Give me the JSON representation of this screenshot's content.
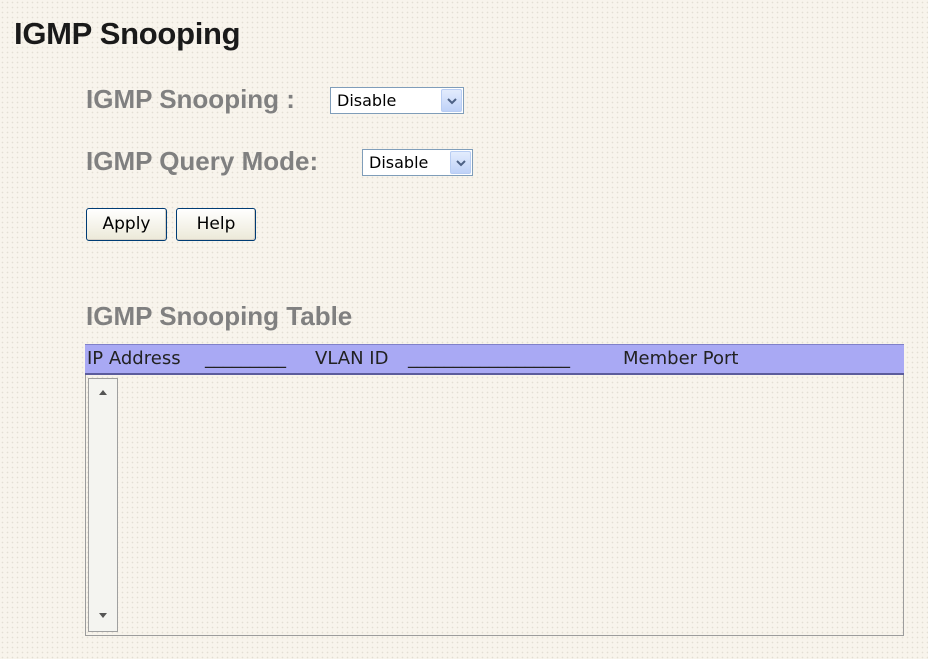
{
  "page": {
    "title": "IGMP Snooping"
  },
  "settings": {
    "snooping_label": "IGMP Snooping :",
    "snooping_value": "Disable",
    "query_mode_label": "IGMP Query Mode:",
    "query_mode_value": "Disable"
  },
  "buttons": {
    "apply_label": "Apply",
    "help_label": "Help"
  },
  "table": {
    "title": "IGMP Snooping Table",
    "columns": [
      "IP Address",
      "VLAN ID",
      "Member Port"
    ],
    "header_separators": [
      "_________",
      "__________________"
    ],
    "rows": []
  },
  "colors": {
    "header_bg": "#a9a9f4",
    "label_gray": "#808080",
    "page_bg": "#f8f4ec"
  },
  "icons": {
    "dropdown": "chevron-down-icon",
    "scroll_up": "scroll-up-arrow-icon",
    "scroll_down": "scroll-down-arrow-icon"
  }
}
